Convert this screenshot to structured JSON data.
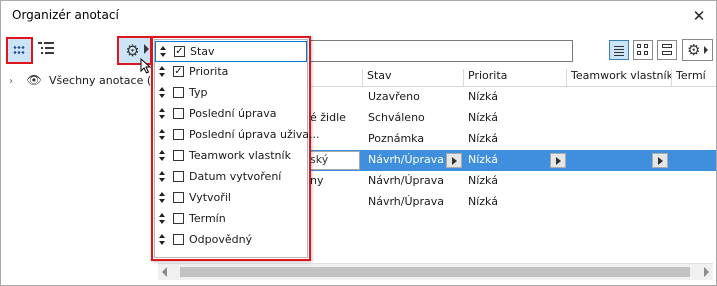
{
  "window": {
    "title": "Organizér anotací",
    "close_glyph": "✕"
  },
  "toolbar": {
    "grid_view_icon": "grid-dots-icon",
    "tree_view_icon": "tree-list-icon",
    "columns_icon": "gear-icon",
    "search_value": "",
    "view_modes": [
      "list-view-icon",
      "grid-view-icon",
      "compact-view-icon"
    ],
    "settings_icon": "gear-icon"
  },
  "tree": {
    "root_label": "Všechny anotace (6)",
    "chevron": "›",
    "eye_icon": "eye-icon"
  },
  "table": {
    "headers": [
      "Stav",
      "Priorita",
      "Teamwork vlastník",
      "Termí"
    ],
    "rows": [
      {
        "name": "",
        "stav": "Uzavřeno",
        "priorita": "Nízká"
      },
      {
        "name": "é židle",
        "stav": "Schváleno",
        "priorita": "Nízká"
      },
      {
        "name": "",
        "stav": "Poznámka",
        "priorita": "Nízká"
      },
      {
        "name": "ský",
        "stav": "Návrh/Úprava",
        "priorita": "Nízká",
        "selected": true
      },
      {
        "name": "ny",
        "stav": "Návrh/Úprava",
        "priorita": "Nízká"
      },
      {
        "name": "",
        "stav": "Návrh/Úprava",
        "priorita": "Nízká"
      }
    ]
  },
  "column_menu": {
    "items": [
      {
        "label": "Stav",
        "checked": true,
        "mark": "✓"
      },
      {
        "label": "Priorita",
        "checked": true,
        "mark": "✓"
      },
      {
        "label": "Typ",
        "checked": false,
        "mark": ""
      },
      {
        "label": "Poslední úprava",
        "checked": false,
        "mark": ""
      },
      {
        "label": "Poslední úprava uživa...",
        "checked": false,
        "mark": ""
      },
      {
        "label": "Teamwork vlastník",
        "checked": false,
        "mark": ""
      },
      {
        "label": "Datum vytvoření",
        "checked": false,
        "mark": ""
      },
      {
        "label": "Vytvořil",
        "checked": false,
        "mark": ""
      },
      {
        "label": "Termín",
        "checked": false,
        "mark": ""
      },
      {
        "label": "Odpovědný",
        "checked": false,
        "mark": ""
      }
    ]
  },
  "colors": {
    "accent": "#3f8fde",
    "highlight": "#e0141c",
    "selected_button": "#cce4f7"
  }
}
